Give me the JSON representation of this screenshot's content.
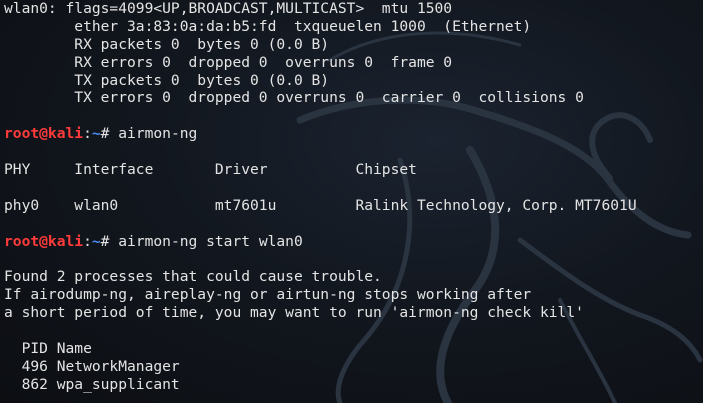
{
  "terminal": {
    "ifconfig": {
      "line1": "wlan0: flags=4099<UP,BROADCAST,MULTICAST>  mtu 1500",
      "line2": "        ether 3a:83:0a:da:b5:fd  txqueuelen 1000  (Ethernet)",
      "line3": "        RX packets 0  bytes 0 (0.0 B)",
      "line4": "        RX errors 0  dropped 0  overruns 0  frame 0",
      "line5": "        TX packets 0  bytes 0 (0.0 B)",
      "line6": "        TX errors 0  dropped 0 overruns 0  carrier 0  collisions 0"
    },
    "prompt": {
      "user": "root@kali",
      "path": "~",
      "symbol": "# "
    },
    "command1": "airmon-ng",
    "airmon_table": {
      "header": "PHY     Interface       Driver          Chipset",
      "row": "phy0    wlan0           mt7601u         Ralink Technology, Corp. MT7601U"
    },
    "command2": "airmon-ng start wlan0",
    "warning": {
      "line1": "Found 2 processes that could cause trouble.",
      "line2": "If airodump-ng, aireplay-ng or airtun-ng stops working after",
      "line3": "a short period of time, you may want to run 'airmon-ng check kill'"
    },
    "processes": {
      "header": "  PID Name",
      "rows": [
        "  496 NetworkManager",
        "  862 wpa_supplicant"
      ]
    }
  },
  "colors": {
    "prompt_user": "#ff3b3b",
    "prompt_path": "#4b8bf5",
    "text": "#e4e4e4",
    "background": "#12171f"
  }
}
